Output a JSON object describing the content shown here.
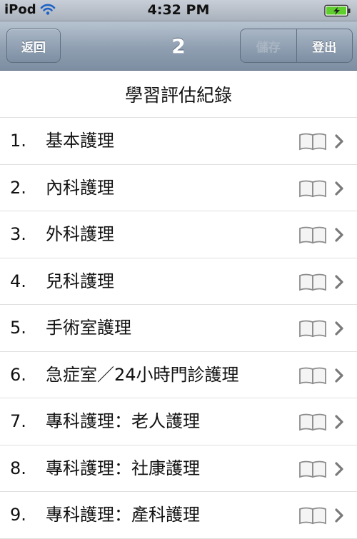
{
  "status_bar": {
    "carrier": "iPod",
    "time": "4:32 PM",
    "battery_color": "#5ecf2c"
  },
  "nav": {
    "back_label": "返回",
    "title": "2",
    "save_label": "儲存",
    "logout_label": "登出"
  },
  "header": {
    "title": "學習評估紀錄"
  },
  "list": {
    "items": [
      {
        "num": "1.",
        "label": "基本護理"
      },
      {
        "num": "2.",
        "label": "內科護理"
      },
      {
        "num": "3.",
        "label": "外科護理"
      },
      {
        "num": "4.",
        "label": "兒科護理"
      },
      {
        "num": "5.",
        "label": "手術室護理"
      },
      {
        "num": "6.",
        "label": "急症室／24小時門診護理"
      },
      {
        "num": "7.",
        "label": "專科護理：老人護理"
      },
      {
        "num": "8.",
        "label": "專科護理：社康護理"
      },
      {
        "num": "9.",
        "label": "專科護理：產科護理"
      }
    ],
    "row_icon": "book-icon",
    "disclosure_icon": "chevron-right-icon"
  }
}
